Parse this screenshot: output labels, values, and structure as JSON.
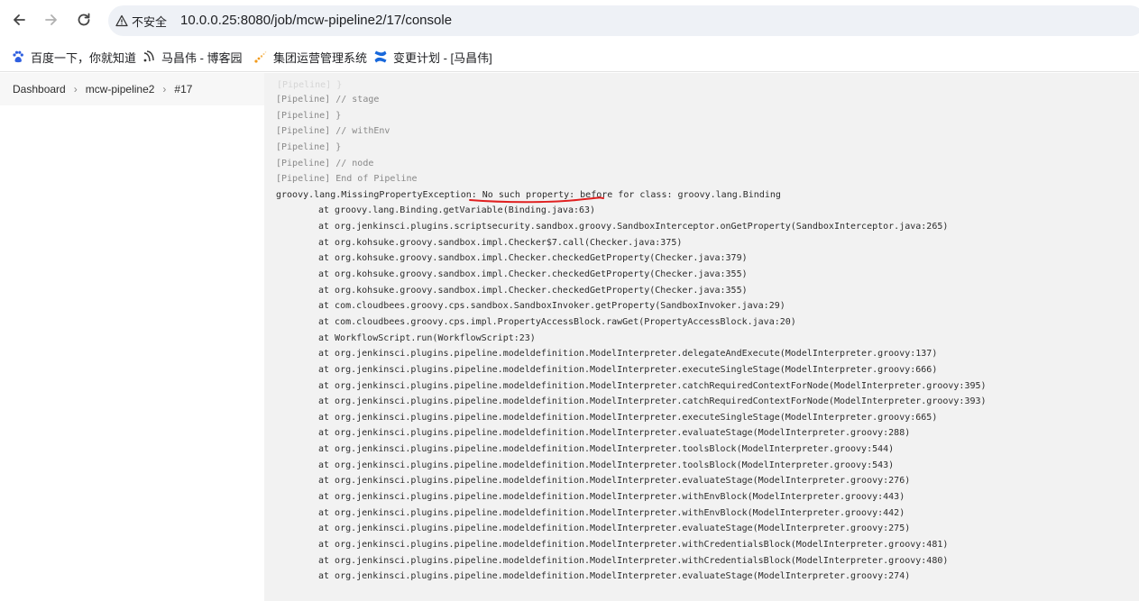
{
  "browser": {
    "security_label": "不安全",
    "url": "10.0.0.25:8080/job/mcw-pipeline2/17/console"
  },
  "bookmarks": [
    {
      "icon": "baidu-paw-icon",
      "label": "百度一下，你就知道"
    },
    {
      "icon": "cnblogs-icon",
      "label": "马昌伟 - 博客园"
    },
    {
      "icon": "loading-dots-icon",
      "label": "集团运营管理系统"
    },
    {
      "icon": "confluence-icon",
      "label": "变更计划 - [马昌伟]"
    }
  ],
  "breadcrumb": [
    "Dashboard",
    "mcw-pipeline2",
    "#17"
  ],
  "console": {
    "lines": [
      {
        "text": "[Pipeline] // stage",
        "kind": "pipeline"
      },
      {
        "text": "[Pipeline] }",
        "kind": "pipeline"
      },
      {
        "text": "[Pipeline] // withEnv",
        "kind": "pipeline"
      },
      {
        "text": "[Pipeline] }",
        "kind": "pipeline"
      },
      {
        "text": "[Pipeline] // node",
        "kind": "pipeline"
      },
      {
        "text": "[Pipeline] End of Pipeline",
        "kind": "pipeline"
      },
      {
        "text": "groovy.lang.MissingPropertyException: No such property: before for class: groovy.lang.Binding",
        "kind": "error"
      },
      {
        "text": "at groovy.lang.Binding.getVariable(Binding.java:63)",
        "kind": "trace"
      },
      {
        "text": "at org.jenkinsci.plugins.scriptsecurity.sandbox.groovy.SandboxInterceptor.onGetProperty(SandboxInterceptor.java:265)",
        "kind": "trace"
      },
      {
        "text": "at org.kohsuke.groovy.sandbox.impl.Checker$7.call(Checker.java:375)",
        "kind": "trace"
      },
      {
        "text": "at org.kohsuke.groovy.sandbox.impl.Checker.checkedGetProperty(Checker.java:379)",
        "kind": "trace"
      },
      {
        "text": "at org.kohsuke.groovy.sandbox.impl.Checker.checkedGetProperty(Checker.java:355)",
        "kind": "trace"
      },
      {
        "text": "at org.kohsuke.groovy.sandbox.impl.Checker.checkedGetProperty(Checker.java:355)",
        "kind": "trace"
      },
      {
        "text": "at com.cloudbees.groovy.cps.sandbox.SandboxInvoker.getProperty(SandboxInvoker.java:29)",
        "kind": "trace"
      },
      {
        "text": "at com.cloudbees.groovy.cps.impl.PropertyAccessBlock.rawGet(PropertyAccessBlock.java:20)",
        "kind": "trace"
      },
      {
        "text": "at WorkflowScript.run(WorkflowScript:23)",
        "kind": "trace"
      },
      {
        "text": "at org.jenkinsci.plugins.pipeline.modeldefinition.ModelInterpreter.delegateAndExecute(ModelInterpreter.groovy:137)",
        "kind": "trace"
      },
      {
        "text": "at org.jenkinsci.plugins.pipeline.modeldefinition.ModelInterpreter.executeSingleStage(ModelInterpreter.groovy:666)",
        "kind": "trace"
      },
      {
        "text": "at org.jenkinsci.plugins.pipeline.modeldefinition.ModelInterpreter.catchRequiredContextForNode(ModelInterpreter.groovy:395)",
        "kind": "trace"
      },
      {
        "text": "at org.jenkinsci.plugins.pipeline.modeldefinition.ModelInterpreter.catchRequiredContextForNode(ModelInterpreter.groovy:393)",
        "kind": "trace"
      },
      {
        "text": "at org.jenkinsci.plugins.pipeline.modeldefinition.ModelInterpreter.executeSingleStage(ModelInterpreter.groovy:665)",
        "kind": "trace"
      },
      {
        "text": "at org.jenkinsci.plugins.pipeline.modeldefinition.ModelInterpreter.evaluateStage(ModelInterpreter.groovy:288)",
        "kind": "trace"
      },
      {
        "text": "at org.jenkinsci.plugins.pipeline.modeldefinition.ModelInterpreter.toolsBlock(ModelInterpreter.groovy:544)",
        "kind": "trace"
      },
      {
        "text": "at org.jenkinsci.plugins.pipeline.modeldefinition.ModelInterpreter.toolsBlock(ModelInterpreter.groovy:543)",
        "kind": "trace"
      },
      {
        "text": "at org.jenkinsci.plugins.pipeline.modeldefinition.ModelInterpreter.evaluateStage(ModelInterpreter.groovy:276)",
        "kind": "trace"
      },
      {
        "text": "at org.jenkinsci.plugins.pipeline.modeldefinition.ModelInterpreter.withEnvBlock(ModelInterpreter.groovy:443)",
        "kind": "trace"
      },
      {
        "text": "at org.jenkinsci.plugins.pipeline.modeldefinition.ModelInterpreter.withEnvBlock(ModelInterpreter.groovy:442)",
        "kind": "trace"
      },
      {
        "text": "at org.jenkinsci.plugins.pipeline.modeldefinition.ModelInterpreter.evaluateStage(ModelInterpreter.groovy:275)",
        "kind": "trace"
      },
      {
        "text": "at org.jenkinsci.plugins.pipeline.modeldefinition.ModelInterpreter.withCredentialsBlock(ModelInterpreter.groovy:481)",
        "kind": "trace"
      },
      {
        "text": "at org.jenkinsci.plugins.pipeline.modeldefinition.ModelInterpreter.withCredentialsBlock(ModelInterpreter.groovy:480)",
        "kind": "trace"
      },
      {
        "text": "at org.jenkinsci.plugins.pipeline.modeldefinition.ModelInterpreter.evaluateStage(ModelInterpreter.groovy:274)",
        "kind": "trace"
      }
    ]
  },
  "colors": {
    "underline_annotation": "#e02020",
    "pipeline_text": "#888888",
    "console_bg": "#f2f2f2"
  }
}
